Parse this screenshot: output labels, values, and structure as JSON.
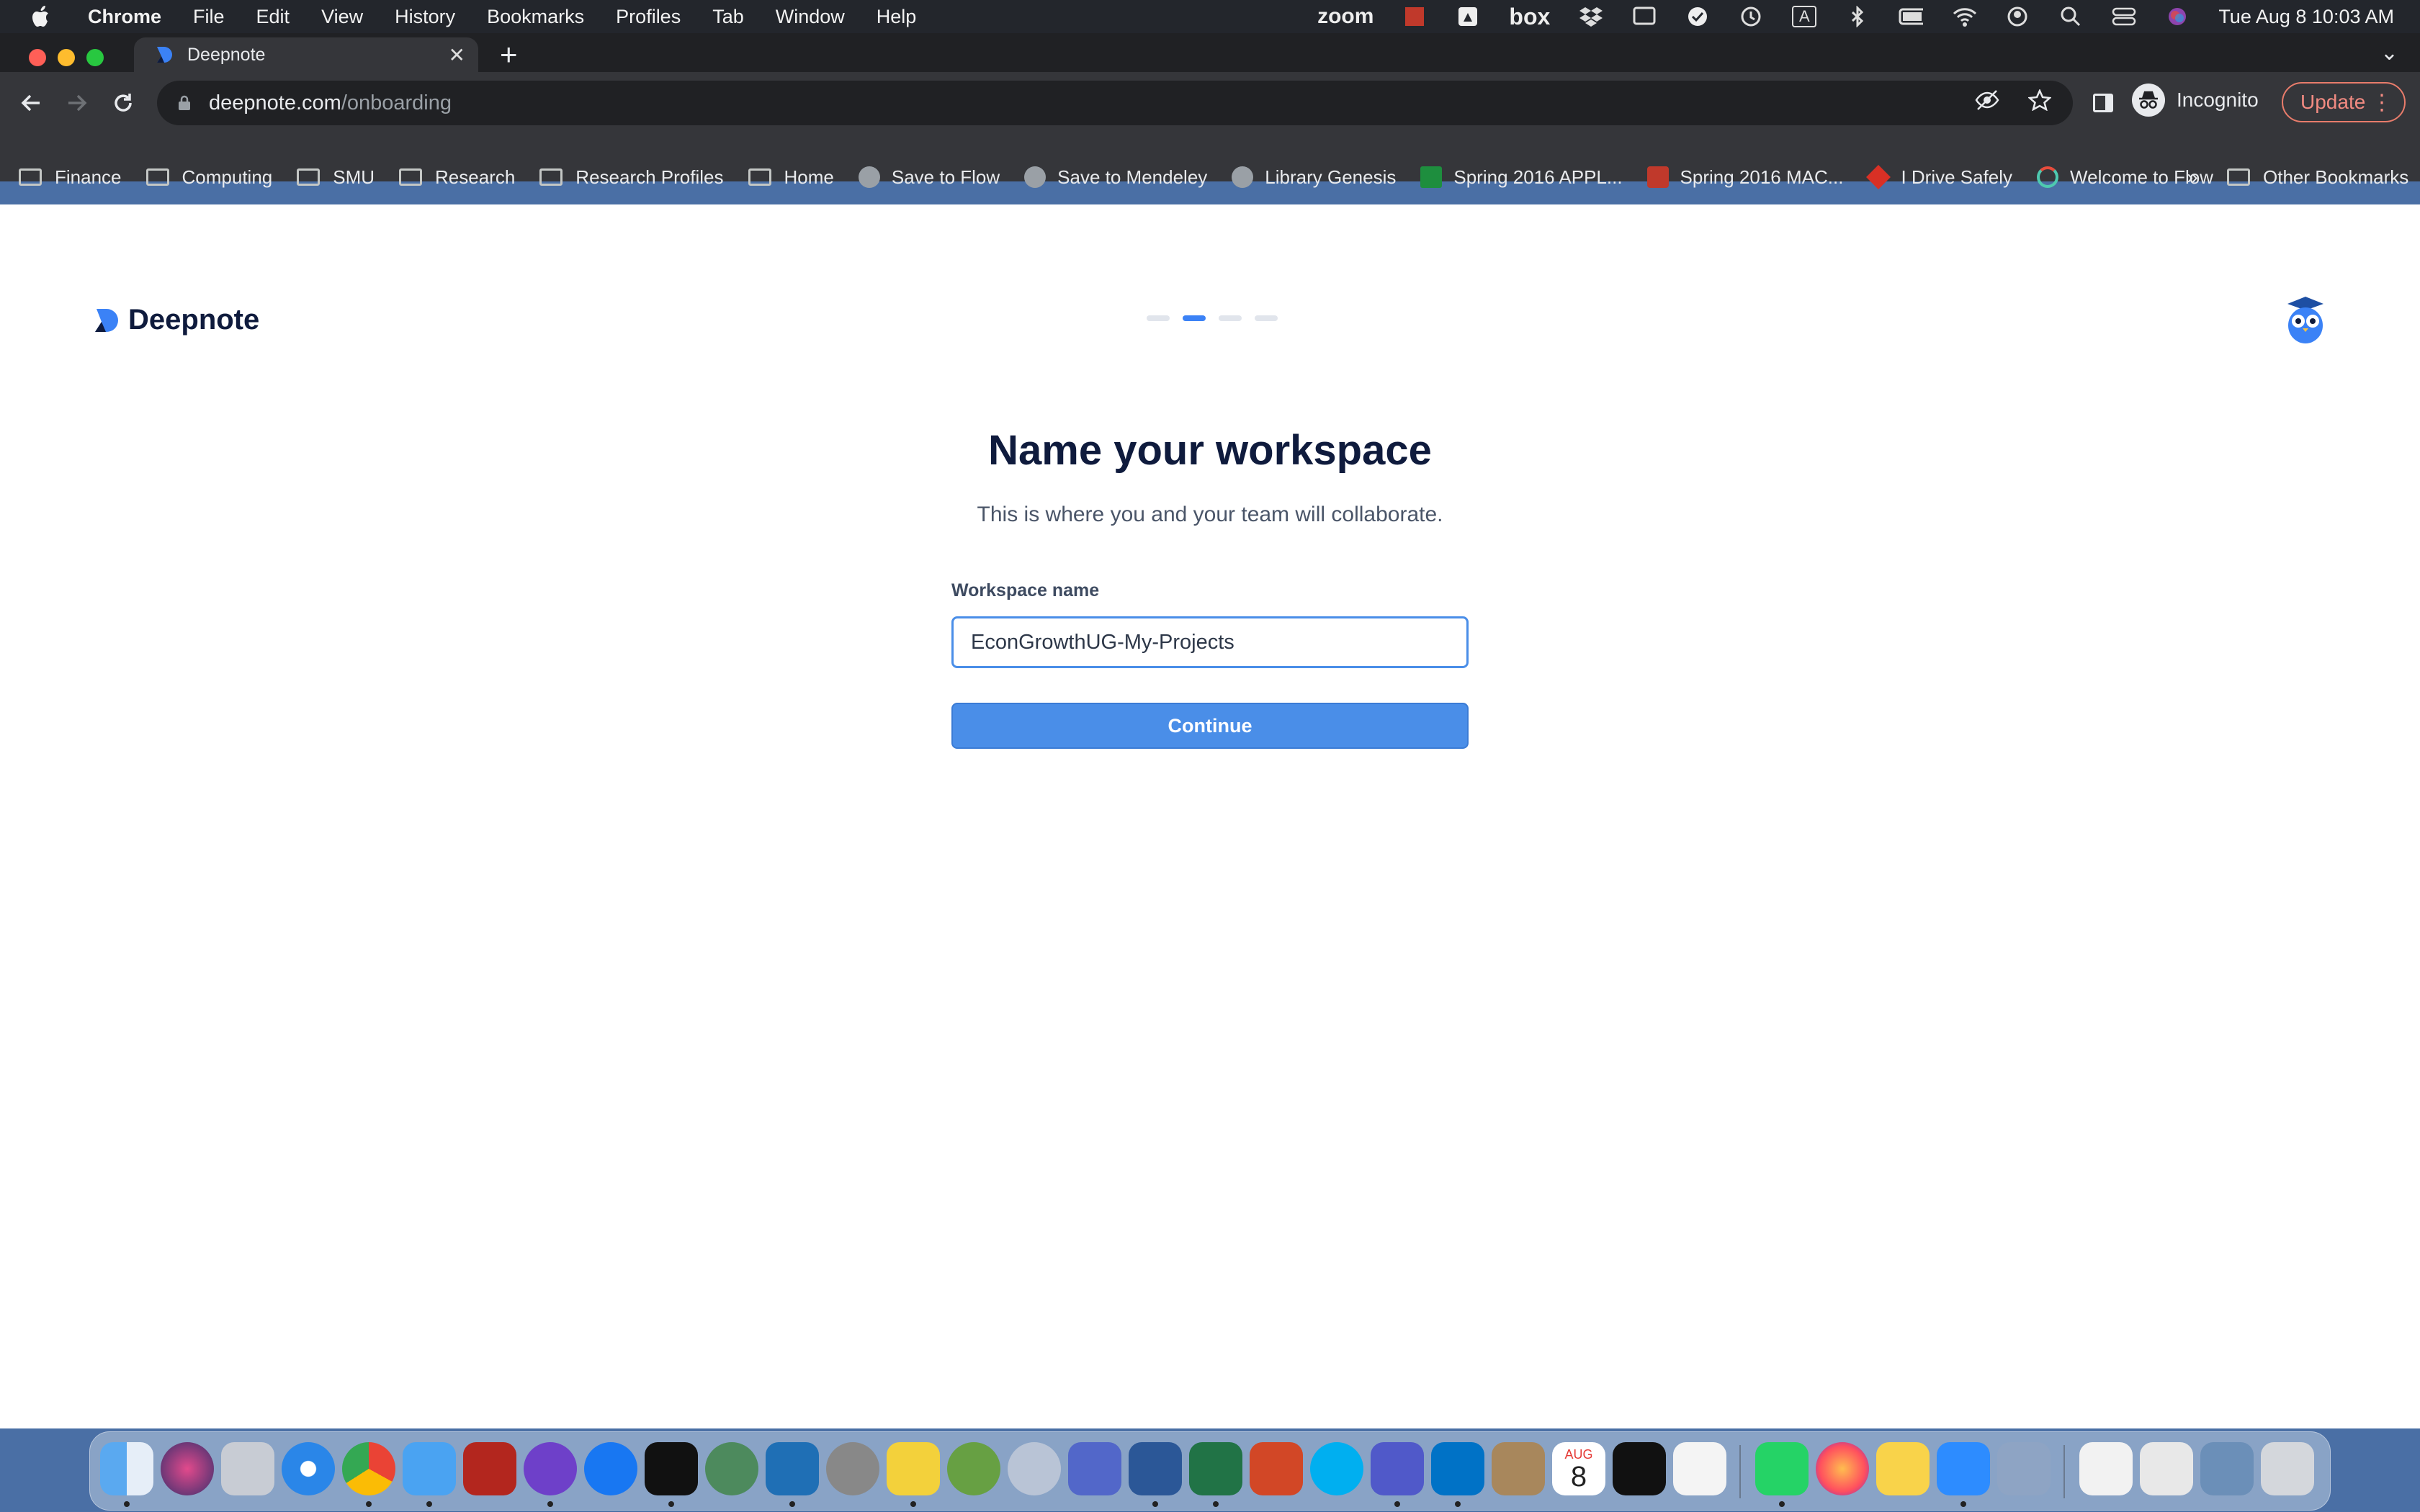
{
  "menubar": {
    "app_name": "Chrome",
    "items": [
      "File",
      "Edit",
      "View",
      "History",
      "Bookmarks",
      "Profiles",
      "Tab",
      "Window",
      "Help"
    ],
    "status_zoom": "zoom",
    "status_box": "box",
    "status_input_letter": "A",
    "clock": "Tue Aug 8  10:03 AM"
  },
  "browser": {
    "tab_title": "Deepnote",
    "url_host": "deepnote.com",
    "url_path": "/onboarding",
    "profile_label": "Incognito",
    "update_label": "Update"
  },
  "bookmarks": [
    {
      "label": "Finance",
      "icon": "folder-icon"
    },
    {
      "label": "Computing",
      "icon": "folder-icon"
    },
    {
      "label": "SMU",
      "icon": "folder-icon"
    },
    {
      "label": "Research",
      "icon": "folder-icon"
    },
    {
      "label": "Research Profiles",
      "icon": "folder-icon"
    },
    {
      "label": "Home",
      "icon": "folder-icon"
    },
    {
      "label": "Save to Flow",
      "icon": "globe-icon"
    },
    {
      "label": "Save to Mendeley",
      "icon": "globe-icon"
    },
    {
      "label": "Library Genesis",
      "icon": "globe-icon"
    },
    {
      "label": "Spring 2016 APPL...",
      "icon": "sheets-icon"
    },
    {
      "label": "Spring 2016 MAC...",
      "icon": "smu-icon"
    },
    {
      "label": "I Drive Safely",
      "icon": "idrive-icon"
    },
    {
      "label": "Welcome to Flow",
      "icon": "flow-icon"
    }
  ],
  "bookmarks_overflow": "»",
  "bookmarks_other": "Other Bookmarks",
  "page": {
    "logo_text": "Deepnote",
    "onboarding_steps_total": 4,
    "onboarding_step_current": 2,
    "heading": "Name your workspace",
    "subheading": "This is where you and your team will collaborate.",
    "field_label": "Workspace name",
    "field_value": "EconGrowthUG-My-Projects",
    "continue_label": "Continue"
  },
  "dock_calendar": {
    "month": "AUG",
    "day": "8"
  },
  "colors": {
    "accent": "#4a8ee8",
    "heading": "#0f1b3d"
  }
}
